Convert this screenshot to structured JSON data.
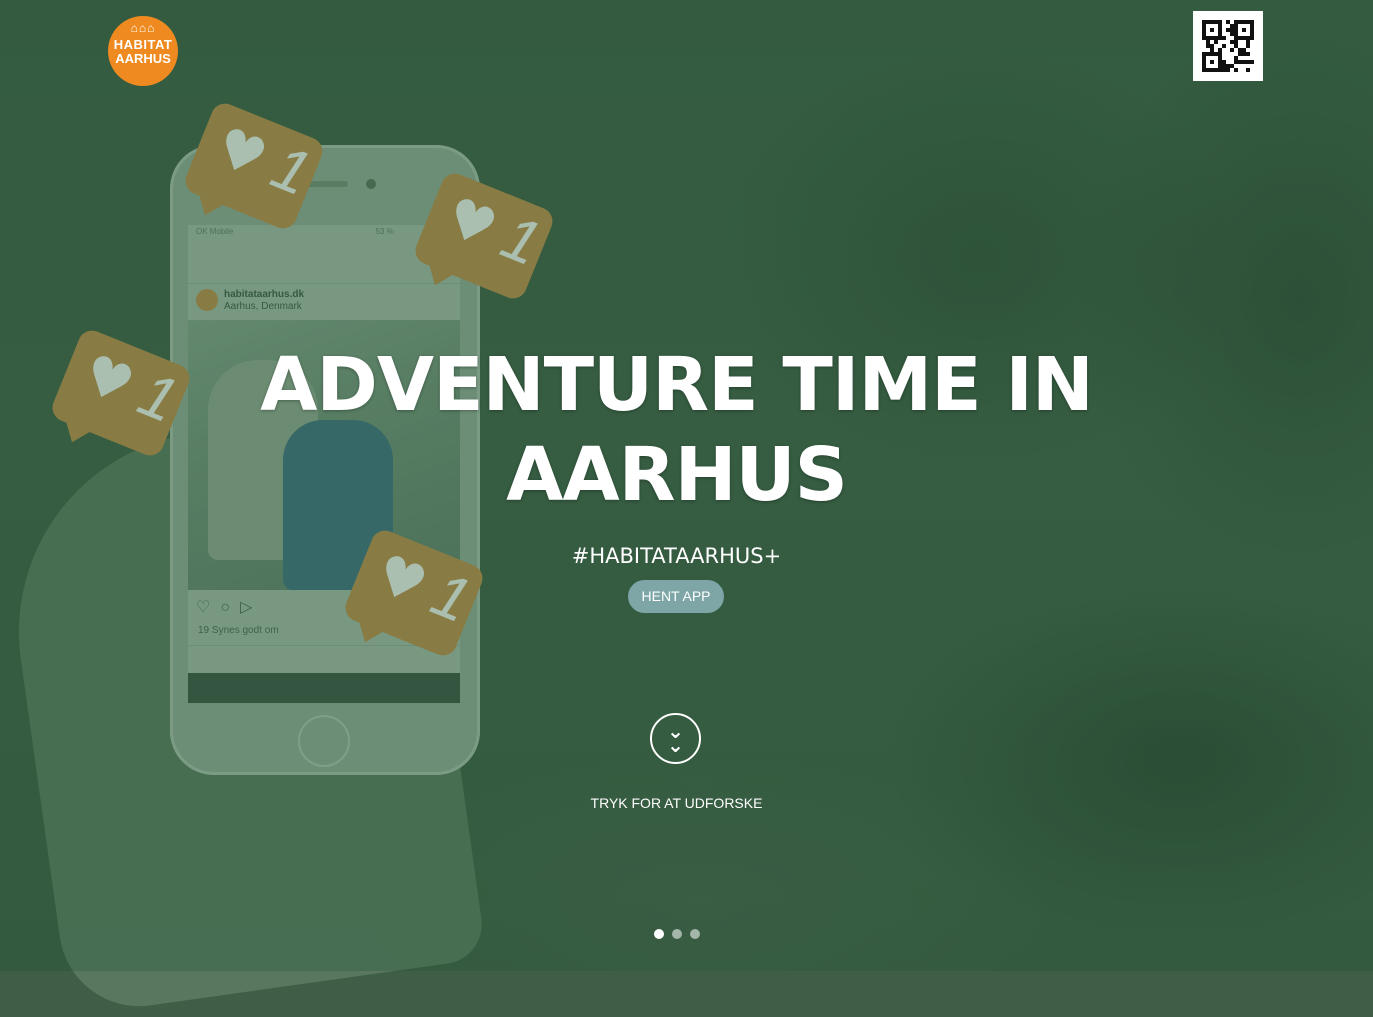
{
  "brand": {
    "logo_line1": "HABITAT",
    "logo_line2": "AARHUS",
    "logo_color": "#ee8a1f"
  },
  "qr": {
    "icon": "qr-code-icon"
  },
  "hero": {
    "title": "ADVENTURE TIME IN AARHUS",
    "hashtag": "#HABITATAARHUS+",
    "cta_label": "HENT APP",
    "cta_color": "#7ea6a6",
    "scroll_icon": "double-chevron-down-icon",
    "explore_label": "TRYK FOR AT UDFORSKE"
  },
  "phone_screen": {
    "status_text": "OK Mobile",
    "battery_text": "53 %",
    "username": "habitataarhus.dk",
    "location": "Aarhus, Denmark",
    "likes_text": "19 Synes godt om"
  },
  "like_badges": [
    {
      "count": "1",
      "icon": "heart-icon"
    },
    {
      "count": "1",
      "icon": "heart-icon"
    },
    {
      "count": "1",
      "icon": "heart-icon"
    },
    {
      "count": "1",
      "icon": "heart-icon"
    }
  ],
  "carousel": {
    "total": 3,
    "active_index": 0
  },
  "colors": {
    "overlay_green": "#3f5e47",
    "badge_orange": "#b0894a"
  }
}
